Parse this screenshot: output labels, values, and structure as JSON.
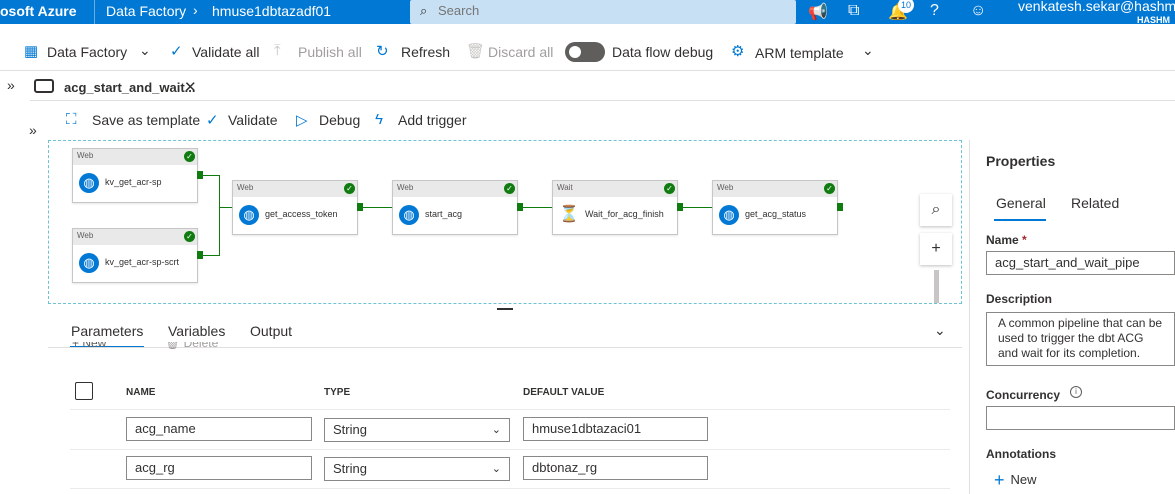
{
  "topbar": {
    "brand": "osoft Azure",
    "crumb1": "Data Factory",
    "crumb2": "hmuse1dbtazadf01",
    "search_placeholder": "Search",
    "notification_count": "10",
    "user": "venkatesh.sekar@hashma",
    "tenant": "HASHM"
  },
  "factory_toolbar": {
    "data_factory": "Data Factory",
    "validate_all": "Validate all",
    "publish_all": "Publish all",
    "refresh": "Refresh",
    "discard_all": "Discard all",
    "data_flow_debug": "Data flow debug",
    "arm_template": "ARM template"
  },
  "tab": {
    "label": "acg_start_and_wait..."
  },
  "pipeline_toolbar": {
    "save_as_template": "Save as template",
    "validate": "Validate",
    "debug": "Debug",
    "add_trigger": "Add trigger"
  },
  "activities": [
    {
      "type": "Web",
      "name": "kv_get_acr-sp"
    },
    {
      "type": "Web",
      "name": "kv_get_acr-sp-scrt"
    },
    {
      "type": "Web",
      "name": "get_access_token"
    },
    {
      "type": "Web",
      "name": "start_acg"
    },
    {
      "type": "Wait",
      "name": "Wait_for_acg_finish"
    },
    {
      "type": "Web",
      "name": "get_acg_status"
    }
  ],
  "bottom_panel": {
    "tabs": [
      "Parameters",
      "Variables",
      "Output"
    ],
    "new_label": "New",
    "delete_label": "Delete",
    "headers": {
      "name": "NAME",
      "type": "TYPE",
      "default": "DEFAULT VALUE"
    },
    "rows": [
      {
        "name": "acg_name",
        "type": "String",
        "default": "hmuse1dbtazaci01"
      },
      {
        "name": "acg_rg",
        "type": "String",
        "default": "dbtonaz_rg"
      }
    ]
  },
  "properties": {
    "title": "Properties",
    "tabs": [
      "General",
      "Related"
    ],
    "name_label": "Name",
    "name_value": "acg_start_and_wait_pipe",
    "description_label": "Description",
    "description_value": "A common pipeline that can be used to trigger the dbt ACG and wait for its completion.",
    "concurrency_label": "Concurrency",
    "annotations_label": "Annotations",
    "new_label": "New"
  },
  "colors": {
    "azure_blue": "#0078d4",
    "success_green": "#107c10"
  }
}
